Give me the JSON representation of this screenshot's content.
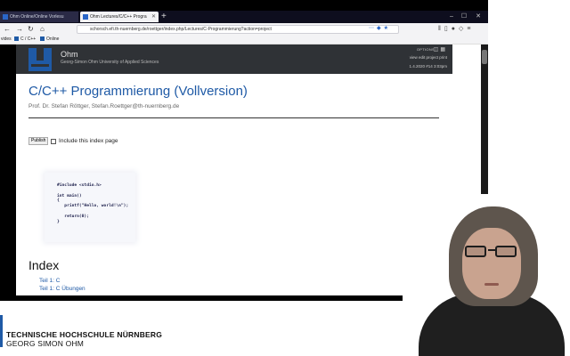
{
  "browser": {
    "tabs": [
      {
        "title": "Ohm Online/Online Vorlesu",
        "active": false
      },
      {
        "title": "Ohm Lectures/C/C++ Progra",
        "active": true
      }
    ],
    "new_tab_icon": "plus-icon",
    "window_controls": [
      "minimize-icon",
      "maximize-icon",
      "close-icon"
    ],
    "nav": {
      "back_icon": "back-arrow-icon",
      "forward_icon": "forward-arrow-icon",
      "reload_icon": "reload-icon",
      "home_icon": "home-icon"
    },
    "url": "schorsch.efi.th-nuernberg.de/roettger/index.php/Lectures/C-Programmierung?action=project",
    "bookmarks": [
      {
        "label": "vides"
      },
      {
        "label": "C / C++"
      },
      {
        "label": "Online"
      }
    ]
  },
  "site": {
    "name": "Ohm",
    "subtitle": "Georg-Simon Ohm University of Applied Sciences",
    "options_label": "OPTIONS",
    "header_links": "view  edit  project  print",
    "date": "1.4.2020 #14  3:03pm"
  },
  "page": {
    "title": "C/C++ Programmierung (Vollversion)",
    "author": "Prof. Dr. Stefan Röttger, Stefan.Roettger@th-nuernberg.de",
    "publish_button": "Publish",
    "include_label": "Include this index page",
    "code": {
      "line1": "#include <stdio.h>",
      "line2": "",
      "line3": "int main()",
      "line4": "{",
      "line5": "   printf(\"Hello, world!\\n\");",
      "line6": "",
      "line7": "   return(0);",
      "line8": "}"
    },
    "index_heading": "Index",
    "index_items": [
      "Teil 1: C",
      "Teil 1: C Übungen"
    ]
  },
  "branding": {
    "name": "TECHNISCHE HOCHSCHULE NÜRNBERG",
    "sub": "GEORG SIMON OHM"
  },
  "colors": {
    "brand_blue": "#1f5aa6",
    "header_dark": "#2f3236"
  }
}
